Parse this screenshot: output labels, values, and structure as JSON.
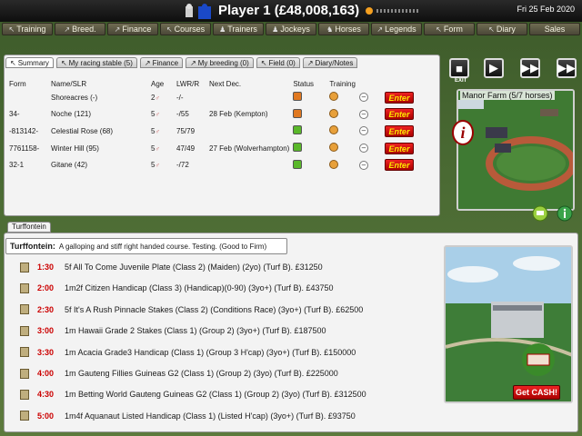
{
  "header": {
    "title": "Player 1  (£48,008,163)",
    "date": "Fri 25 Feb 2020"
  },
  "menu": [
    {
      "label": "Training"
    },
    {
      "label": "Breed."
    },
    {
      "label": "Finance"
    },
    {
      "label": "Courses"
    },
    {
      "label": "Trainers"
    },
    {
      "label": "Jockeys"
    },
    {
      "label": "Horses"
    },
    {
      "label": "Legends"
    },
    {
      "label": "Form"
    },
    {
      "label": "Diary"
    },
    {
      "label": "Sales"
    }
  ],
  "tabs": [
    {
      "label": "Summary"
    },
    {
      "label": "My racing stable (5)"
    },
    {
      "label": "Finance"
    },
    {
      "label": "My breeding (0)"
    },
    {
      "label": "Field (0)"
    },
    {
      "label": "Diary/Notes"
    }
  ],
  "table": {
    "headers": [
      "Form",
      "Name/SLR",
      "Age",
      "LWR/R",
      "Next Dec.",
      "Status",
      "Training"
    ],
    "rows": [
      {
        "form": "",
        "name": "Shoreacres (-)",
        "age": "2",
        "lwr": "-/-",
        "next": "",
        "status": "#e07820",
        "enter": "Enter"
      },
      {
        "form": "34-",
        "name": "Noche (121)",
        "age": "5",
        "lwr": "-/55",
        "next": "28 Feb (Kempton)",
        "status": "#e07820",
        "enter": "Enter"
      },
      {
        "form": "-813142-",
        "name": "Celestial Rose (68)",
        "age": "5",
        "lwr": "75/79",
        "next": "",
        "status": "#5ab82a",
        "enter": "Enter"
      },
      {
        "form": "7761158-",
        "name": "Winter Hill (95)",
        "age": "5",
        "lwr": "47/49",
        "next": "27 Feb (Wolverhampton)",
        "status": "#5ab82a",
        "enter": "Enter"
      },
      {
        "form": "32-1",
        "name": "Gitane (42)",
        "age": "5",
        "lwr": "-/72",
        "next": "",
        "status": "#5ab82a",
        "enter": "Enter"
      }
    ]
  },
  "controls": {
    "exit": "EXIT"
  },
  "farm": {
    "label": "Manor Farm  (5/7 horses)"
  },
  "course": {
    "tab": "Turffontein",
    "name": "Turffontein:",
    "description": "A galloping and stiff right handed course. Testing.  (Good to Firm)"
  },
  "races": [
    {
      "time": "1:30",
      "text": "5f All To Come Juvenile Plate (Class 2) (Maiden) (2yo) (Turf B).  £31250"
    },
    {
      "time": "2:00",
      "text": "1m2f Citizen Handicap (Class 3) (Handicap)(0-90) (3yo+) (Turf B).  £43750"
    },
    {
      "time": "2:30",
      "text": "5f It's A Rush Pinnacle Stakes (Class 2) (Conditions Race) (3yo+) (Turf B). £62500"
    },
    {
      "time": "3:00",
      "text": "1m Hawaii Grade 2 Stakes (Class 1) (Group 2) (3yo+) (Turf B).  £187500"
    },
    {
      "time": "3:30",
      "text": "1m Acacia Grade3 Handicap (Class 1) (Group 3 H'cap) (3yo+) (Turf B).  £150000"
    },
    {
      "time": "4:00",
      "text": "1m Gauteng Fillies Guineas G2 (Class 1) (Group 2) (3yo) (Turf B).  £225000"
    },
    {
      "time": "4:30",
      "text": "1m Betting World Gauteng Guineas G2 (Class 1) (Group 2) (3yo) (Turf B).  £312500"
    },
    {
      "time": "5:00",
      "text": "1m4f Aquanaut Listed Handicap (Class 1) (Listed H'cap) (3yo+) (Turf B).  £93750"
    }
  ],
  "cash": {
    "label": "Get CASH!"
  }
}
